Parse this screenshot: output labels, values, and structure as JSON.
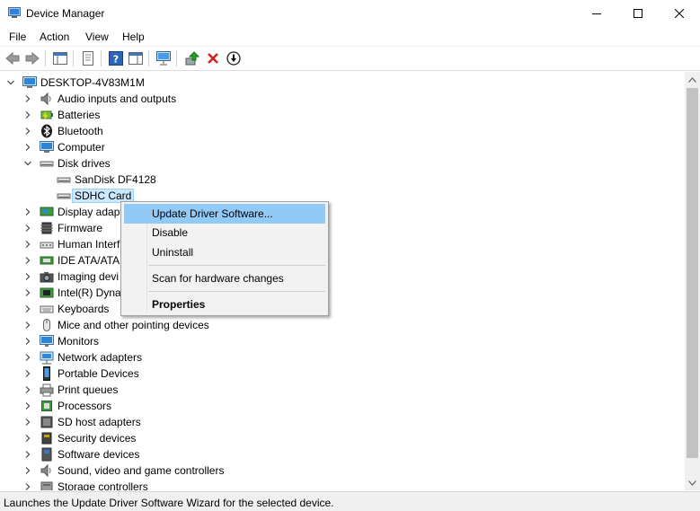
{
  "window": {
    "title": "Device Manager"
  },
  "menu": [
    "File",
    "Action",
    "View",
    "Help"
  ],
  "toolbar": {
    "buttons": [
      "back-icon",
      "forward-icon",
      "show-hide-console-tree-icon",
      "properties-icon",
      "help-icon",
      "action-pane-icon",
      "scan-monitor-icon",
      "update-driver-icon",
      "uninstall-x-icon",
      "disable-down-icon"
    ]
  },
  "tree": {
    "root": "DESKTOP-4V83M1M",
    "items": [
      {
        "label": "Audio inputs and outputs",
        "icon": "speaker-icon",
        "expanded": false
      },
      {
        "label": "Batteries",
        "icon": "battery-icon",
        "expanded": false
      },
      {
        "label": "Bluetooth",
        "icon": "bluetooth-icon",
        "expanded": false
      },
      {
        "label": "Computer",
        "icon": "computer-icon",
        "expanded": false
      },
      {
        "label": "Disk drives",
        "icon": "disk-drive-icon",
        "expanded": true
      },
      {
        "label": "SanDisk DF4128",
        "icon": "disk-drive-icon",
        "child": true
      },
      {
        "label": "SDHC Card",
        "icon": "disk-drive-icon",
        "child": true,
        "selected": true
      },
      {
        "label": "Display adapt",
        "icon": "display-adapter-icon",
        "expanded": false
      },
      {
        "label": "Firmware",
        "icon": "firmware-icon",
        "expanded": false
      },
      {
        "label": "Human Interf",
        "icon": "hid-icon",
        "expanded": false
      },
      {
        "label": "IDE ATA/ATAP",
        "icon": "ide-controller-icon",
        "expanded": false
      },
      {
        "label": "Imaging devi",
        "icon": "camera-icon",
        "expanded": false
      },
      {
        "label": "Intel(R) Dyna",
        "icon": "intel-icon",
        "expanded": false
      },
      {
        "label": "Keyboards",
        "icon": "keyboard-icon",
        "expanded": false
      },
      {
        "label": "Mice and other pointing devices",
        "icon": "mouse-icon",
        "expanded": false
      },
      {
        "label": "Monitors",
        "icon": "monitor-icon",
        "expanded": false
      },
      {
        "label": "Network adapters",
        "icon": "network-adapter-icon",
        "expanded": false
      },
      {
        "label": "Portable Devices",
        "icon": "portable-device-icon",
        "expanded": false
      },
      {
        "label": "Print queues",
        "icon": "printer-icon",
        "expanded": false
      },
      {
        "label": "Processors",
        "icon": "processor-icon",
        "expanded": false
      },
      {
        "label": "SD host adapters",
        "icon": "sd-host-icon",
        "expanded": false
      },
      {
        "label": "Security devices",
        "icon": "security-device-icon",
        "expanded": false
      },
      {
        "label": "Software devices",
        "icon": "software-device-icon",
        "expanded": false
      },
      {
        "label": "Sound, video and game controllers",
        "icon": "sound-controller-icon",
        "expanded": false
      },
      {
        "label": "Storage controllers",
        "icon": "storage-controller-icon",
        "expanded": false
      }
    ]
  },
  "context_menu": {
    "items": [
      {
        "label": "Update Driver Software...",
        "highlighted": true
      },
      {
        "label": "Disable"
      },
      {
        "label": "Uninstall"
      },
      {
        "label": "Scan for hardware changes"
      },
      {
        "label": "Properties",
        "bold": true
      }
    ]
  },
  "status": {
    "text": "Launches the Update Driver Software Wizard for the selected device."
  },
  "colors": {
    "selection": "#cce8ff",
    "menu_highlight": "#91c9f7",
    "menu_bg": "#f2f2f2"
  }
}
